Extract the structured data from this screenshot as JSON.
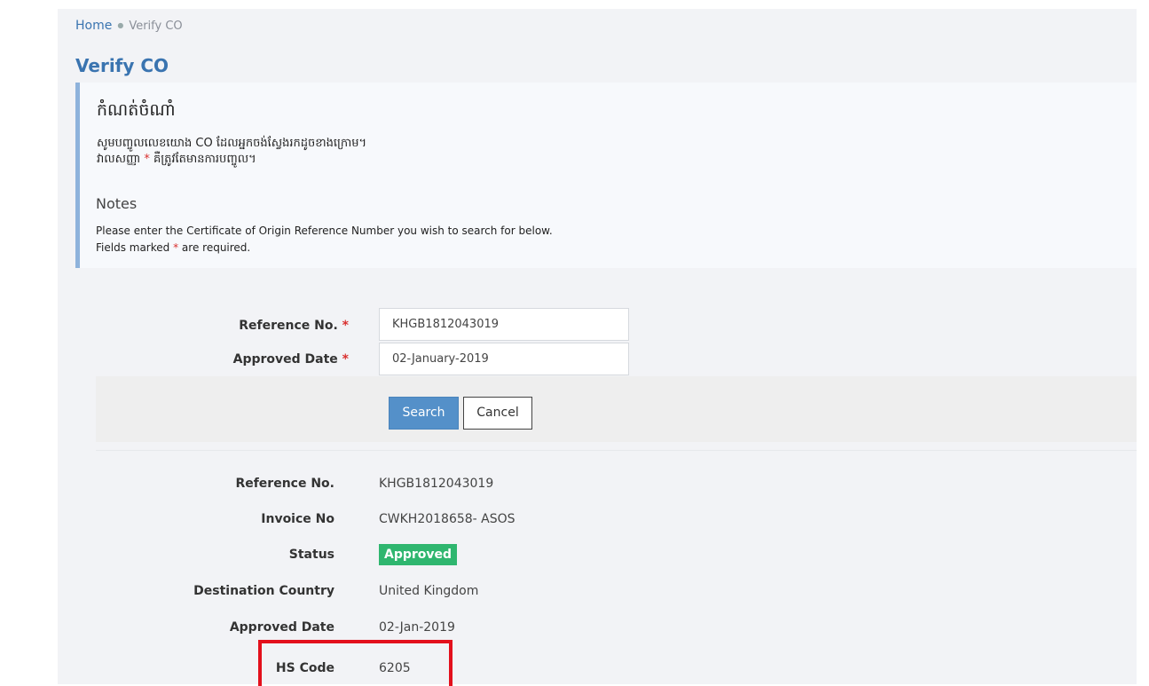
{
  "breadcrumb": {
    "home": "Home",
    "current": "Verify CO"
  },
  "page_title": "Verify CO",
  "notes": {
    "km_title": "កំណត់ចំណាំ",
    "km_line1": "សូមបញ្ចូលលេខយោង CO ដែលអ្នកចង់ស្វែងរកដូចខាងក្រោម។",
    "km_line2_a": "វាលសញ្ញា",
    "km_line2_b": "គឺត្រូវតែមានការបញ្ចូល។",
    "title": "Notes",
    "line1": "Please enter the Certificate of Origin Reference Number you wish to search for below.",
    "line2_a": "Fields marked",
    "line2_b": "are required.",
    "required_mark": "*"
  },
  "form": {
    "reference_label": "Reference No.",
    "reference_value": "KHGB1812043019",
    "approved_date_label": "Approved Date",
    "approved_date_value": "02-January-2019",
    "required_mark": "*",
    "search_button": "Search",
    "cancel_button": "Cancel"
  },
  "result": {
    "rows": [
      {
        "label": "Reference No.",
        "value": "KHGB1812043019"
      },
      {
        "label": "Invoice No",
        "value": "CWKH2018658- ASOS"
      },
      {
        "label": "Status",
        "value": "Approved"
      },
      {
        "label": "Destination Country",
        "value": "United Kingdom"
      },
      {
        "label": "Approved Date",
        "value": "02-Jan-2019"
      },
      {
        "label": "HS Code",
        "value": "6205"
      }
    ]
  },
  "colors": {
    "accent": "#3a74b0",
    "status_approved": "#2fb66f",
    "highlight": "#e3101c",
    "button_primary": "#5490c9"
  }
}
